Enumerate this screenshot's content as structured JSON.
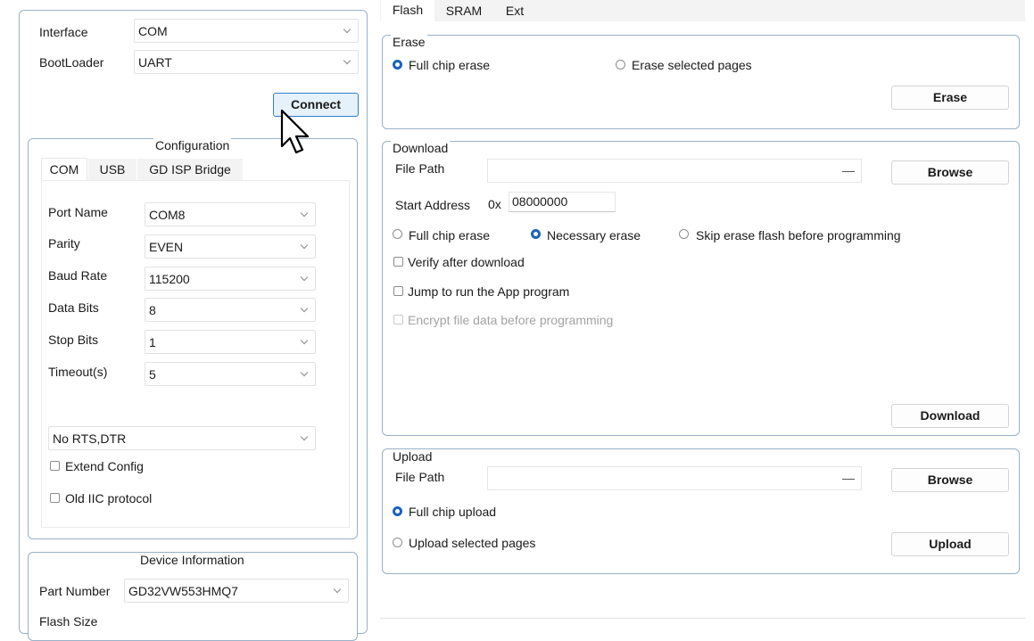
{
  "left": {
    "interface_label": "Interface",
    "interface_value": "COM",
    "bootloader_label": "BootLoader",
    "bootloader_value": "UART",
    "connect_label": "Connect",
    "configuration": {
      "title": "Configuration",
      "tabs": [
        "COM",
        "USB",
        "GD ISP Bridge"
      ],
      "fields": [
        {
          "label": "Port Name",
          "value": "COM8"
        },
        {
          "label": "Parity",
          "value": "EVEN"
        },
        {
          "label": "Baud Rate",
          "value": "115200"
        },
        {
          "label": "Data Bits",
          "value": "8"
        },
        {
          "label": "Stop Bits",
          "value": "1"
        },
        {
          "label": "Timeout(s)",
          "value": "5"
        }
      ],
      "rts_value": "No RTS,DTR",
      "extend_config": "Extend Config",
      "old_iic": "Old IIC protocol"
    },
    "device": {
      "title": "Device Information",
      "part_number_label": "Part Number",
      "part_number_value": "GD32VW553HMQ7",
      "flash_size_label": "Flash Size"
    }
  },
  "tabs": [
    "Flash",
    "SRAM",
    "Ext"
  ],
  "erase": {
    "title": "Erase",
    "full_chip": "Full chip erase",
    "selected_pages": "Erase selected pages",
    "button": "Erase"
  },
  "download": {
    "title": "Download",
    "file_path_label": "File Path",
    "browse": "Browse",
    "start_address_label": "Start Address",
    "address_prefix": "0x",
    "start_address_value": "08000000",
    "opt_full_chip": "Full chip erase",
    "opt_necessary": "Necessary erase",
    "opt_skip": "Skip erase flash before programming",
    "verify": "Verify after download",
    "jump": "Jump to run the App program",
    "encrypt": "Encrypt file data before programming",
    "button": "Download"
  },
  "upload": {
    "title": "Upload",
    "file_path_label": "File Path",
    "browse": "Browse",
    "full_chip": "Full chip upload",
    "selected_pages": "Upload selected pages",
    "button": "Upload"
  },
  "colors": {
    "group_border": "#9ab1c7",
    "radio_selected": "#1a62b8",
    "primary_button_bg": "#e5f1fb",
    "primary_button_border": "#2e7fd1",
    "tab_active_bg": "#ffffff",
    "tab_inactive_bg": "#f3f3f3"
  },
  "icons": [
    "chevron-down-icon",
    "mouse-cursor-icon",
    "radio-icon",
    "checkbox-icon",
    "clear-path-icon"
  ]
}
